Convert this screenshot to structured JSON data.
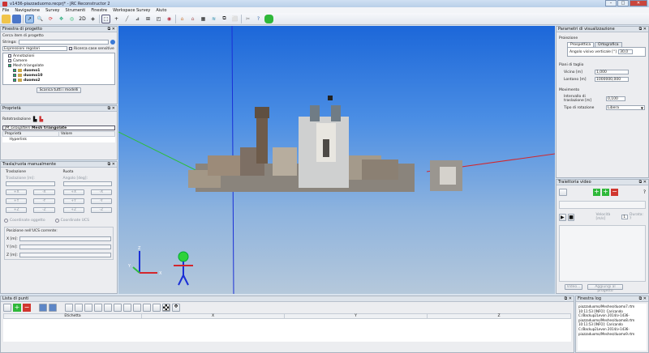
{
  "window": {
    "title": "v1436-piazzaduomo.recprj* - JRC Reconstructor 2",
    "min": "–",
    "max": "□",
    "close": "✕"
  },
  "menu": [
    "File",
    "Navigazione",
    "Survey",
    "Strumenti",
    "Finestre",
    "Workspace Survey",
    "Aiuto"
  ],
  "project_panel": {
    "title": "Finestra di progetto",
    "search_label": "Cerca item di progetto",
    "string_label": "Stringa:",
    "string_value": "",
    "regex_value": "Espressioni regolari",
    "case_label": "Ricerca case sensitive",
    "tree": [
      {
        "label": "Annotazioni",
        "bold": false,
        "depth": 1
      },
      {
        "label": "Camere",
        "bold": false,
        "depth": 1
      },
      {
        "label": "Mesh triangolate",
        "bold": false,
        "depth": 1
      },
      {
        "label": "duomo1",
        "bold": true,
        "depth": 2
      },
      {
        "label": "duomo10",
        "bold": true,
        "depth": 2
      },
      {
        "label": "duomo2",
        "bold": true,
        "depth": 2
      }
    ],
    "unload_button": "Scarica tutti i modelli"
  },
  "properties_panel": {
    "title": "Proprietà",
    "rototraslazione": "Rototraslazione",
    "group_item": "Mesh triangolate",
    "group_prefix": "JM_GroupItem",
    "col_property": "Proprietà",
    "col_value": "Valore",
    "row_hyperlink": "Hyperlink"
  },
  "transform_panel": {
    "title": "Trasla/ruota manualmente",
    "translate_title": "Traslazione",
    "rotate_title": "Ruota",
    "translate_unit": "Traslazione [m]:",
    "rotate_unit": "Angolo [deg]:",
    "buttons_left": [
      "+X",
      "-X",
      "+Y",
      "-Y",
      "+Z",
      "-Z"
    ],
    "buttons_right": [
      "+X",
      "-X",
      "+Y",
      "-Y",
      "+Z",
      "-Z"
    ],
    "radio_object": "Coordinate oggetto",
    "radio_ucs": "Coordinate UCS",
    "ucs_position": "Posizione nell'UCS corrente:",
    "coord_x": "X [m]:",
    "coord_y": "Y [m]:",
    "coord_z": "Z [m]:"
  },
  "viz_panel": {
    "title": "Parametri di visualizzazione",
    "projection_title": "Proiezione",
    "tab_perspective": "Prospettica",
    "tab_ortho": "Ortografica",
    "fov_label": "Angolo visivo verticale [°]",
    "fov_value": "30,0",
    "clip_title": "Piani di taglio",
    "near_label": "Vicino [m]",
    "near_value": "1,000",
    "far_label": "Lontano [m]",
    "far_value": "1000000,000",
    "move_title": "Movimento",
    "step_label": "Intervallo di traslazione [m]",
    "step_value": "0,100",
    "rot_label": "Tipo di rotazione",
    "rot_value": "Libera"
  },
  "video_panel": {
    "title": "Traiettoria video",
    "speed_label": "Velocità [m/s]",
    "speed_value": "1",
    "duration_label": "Durata: ?",
    "video_button": "Video...",
    "add_button": "Aggiungi al progetto"
  },
  "points_panel": {
    "title": "Lista di punti",
    "columns": [
      "Etichetta",
      "X",
      "Y",
      "Z"
    ]
  },
  "log_panel": {
    "title": "Finestra log",
    "lines": [
      "piazzaduomo/Meshes/duomo7.rtm",
      "10:11:53 [INFO]: Caricando",
      "C:/Backup2Levon 2014/v-1436-",
      "piazzaduomo/Meshes/duomo8.rtm",
      "10:11:53 [INFO]: Caricando",
      "C:/Backup2Levon 2014/v-1436-",
      "piazzaduomo/Meshes/duomo9.rtm"
    ]
  },
  "toolbar_icons": [
    "open-icon",
    "save-icon",
    "navigate-icon",
    "zoom-icon",
    "rotate-icon",
    "pan-icon",
    "target-icon",
    "2d-icon",
    "3d-icon",
    "select-icon",
    "point-icon",
    "line-icon",
    "measure-icon",
    "home-icon",
    "house-icon",
    "clip-icon",
    "section-icon",
    "grid-icon",
    "layer-icon",
    "camera-icon",
    "frame-icon",
    "box-icon",
    "cut-icon",
    "help-icon",
    "frog-icon"
  ],
  "colors": {
    "viewport_top": "#1c67d9",
    "viewport_bottom": "#b5c8db",
    "axis_x": "#d3262c",
    "axis_y": "#2fbd3e",
    "axis_z": "#1a2fd6",
    "accent_green": "#2fb83a",
    "accent_red": "#d0372f"
  }
}
